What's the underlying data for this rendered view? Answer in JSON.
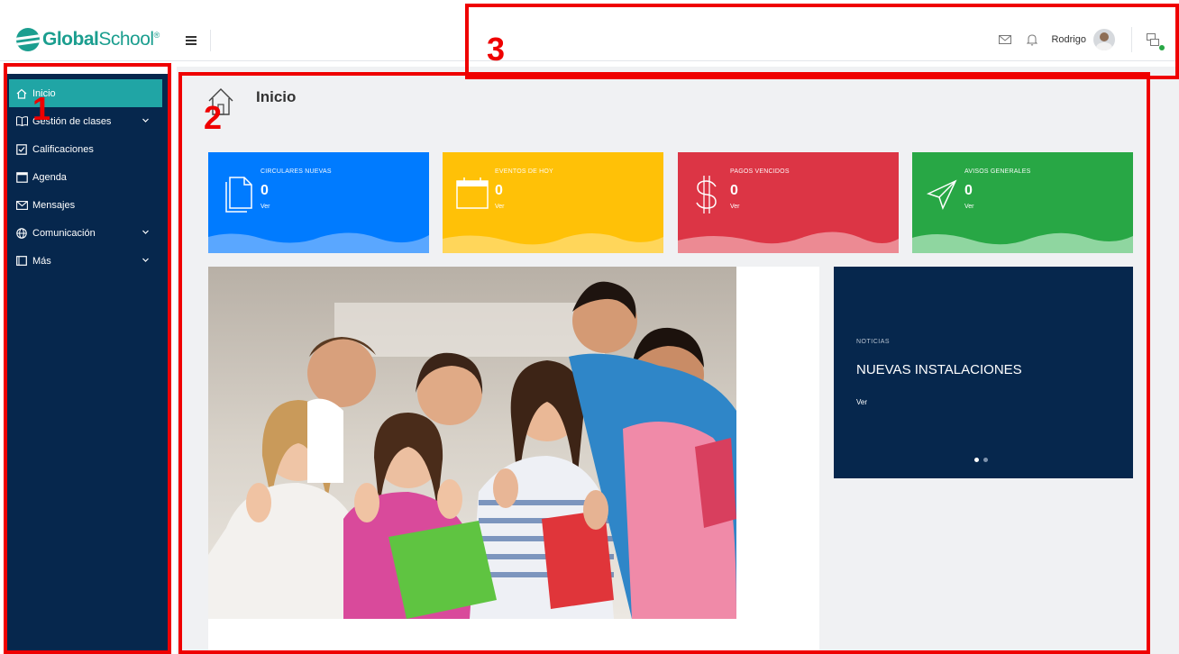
{
  "brand": {
    "name_bold": "Global",
    "name_rest": "School",
    "mark": "®"
  },
  "topbar": {
    "menu_icon": "hamburger-icon",
    "user_name": "Rodrigo",
    "icons": [
      "mail-icon",
      "bell-icon",
      "avatar",
      "window-switch-icon"
    ]
  },
  "sidebar": {
    "items": [
      {
        "label": "Inicio",
        "icon": "home-icon",
        "active": true
      },
      {
        "label": "Gestión de clases",
        "icon": "book-icon",
        "expandable": true
      },
      {
        "label": "Calificaciones",
        "icon": "check-square-icon"
      },
      {
        "label": "Agenda",
        "icon": "calendar-icon"
      },
      {
        "label": "Mensajes",
        "icon": "mail-icon"
      },
      {
        "label": "Comunicación",
        "icon": "globe-icon",
        "expandable": true
      },
      {
        "label": "Más",
        "icon": "square-icon",
        "expandable": true
      }
    ]
  },
  "page": {
    "title": "Inicio"
  },
  "cards": [
    {
      "label": "CIRCULARES NUEVAS",
      "value": "0",
      "link": "Ver",
      "color": "#007bff",
      "icon": "document-icon"
    },
    {
      "label": "EVENTOS DE HOY",
      "value": "0",
      "link": "Ver",
      "color": "#ffc107",
      "icon": "calendar-icon"
    },
    {
      "label": "PAGOS VENCIDOS",
      "value": "0",
      "link": "Ver",
      "color": "#dc3545",
      "icon": "dollar-icon"
    },
    {
      "label": "AVISOS GENERALES",
      "value": "0",
      "link": "Ver",
      "color": "#28a745",
      "icon": "send-icon"
    }
  ],
  "news": {
    "kicker": "NOTICIAS",
    "headline": "NUEVAS INSTALACIONES",
    "link": "Ver",
    "slides": 2,
    "active_slide": 1
  },
  "annotations": [
    "1",
    "2",
    "3"
  ],
  "colors": {
    "sidebar": "#06274d",
    "accent": "#20a5a5",
    "highlight": "#ef0000"
  }
}
